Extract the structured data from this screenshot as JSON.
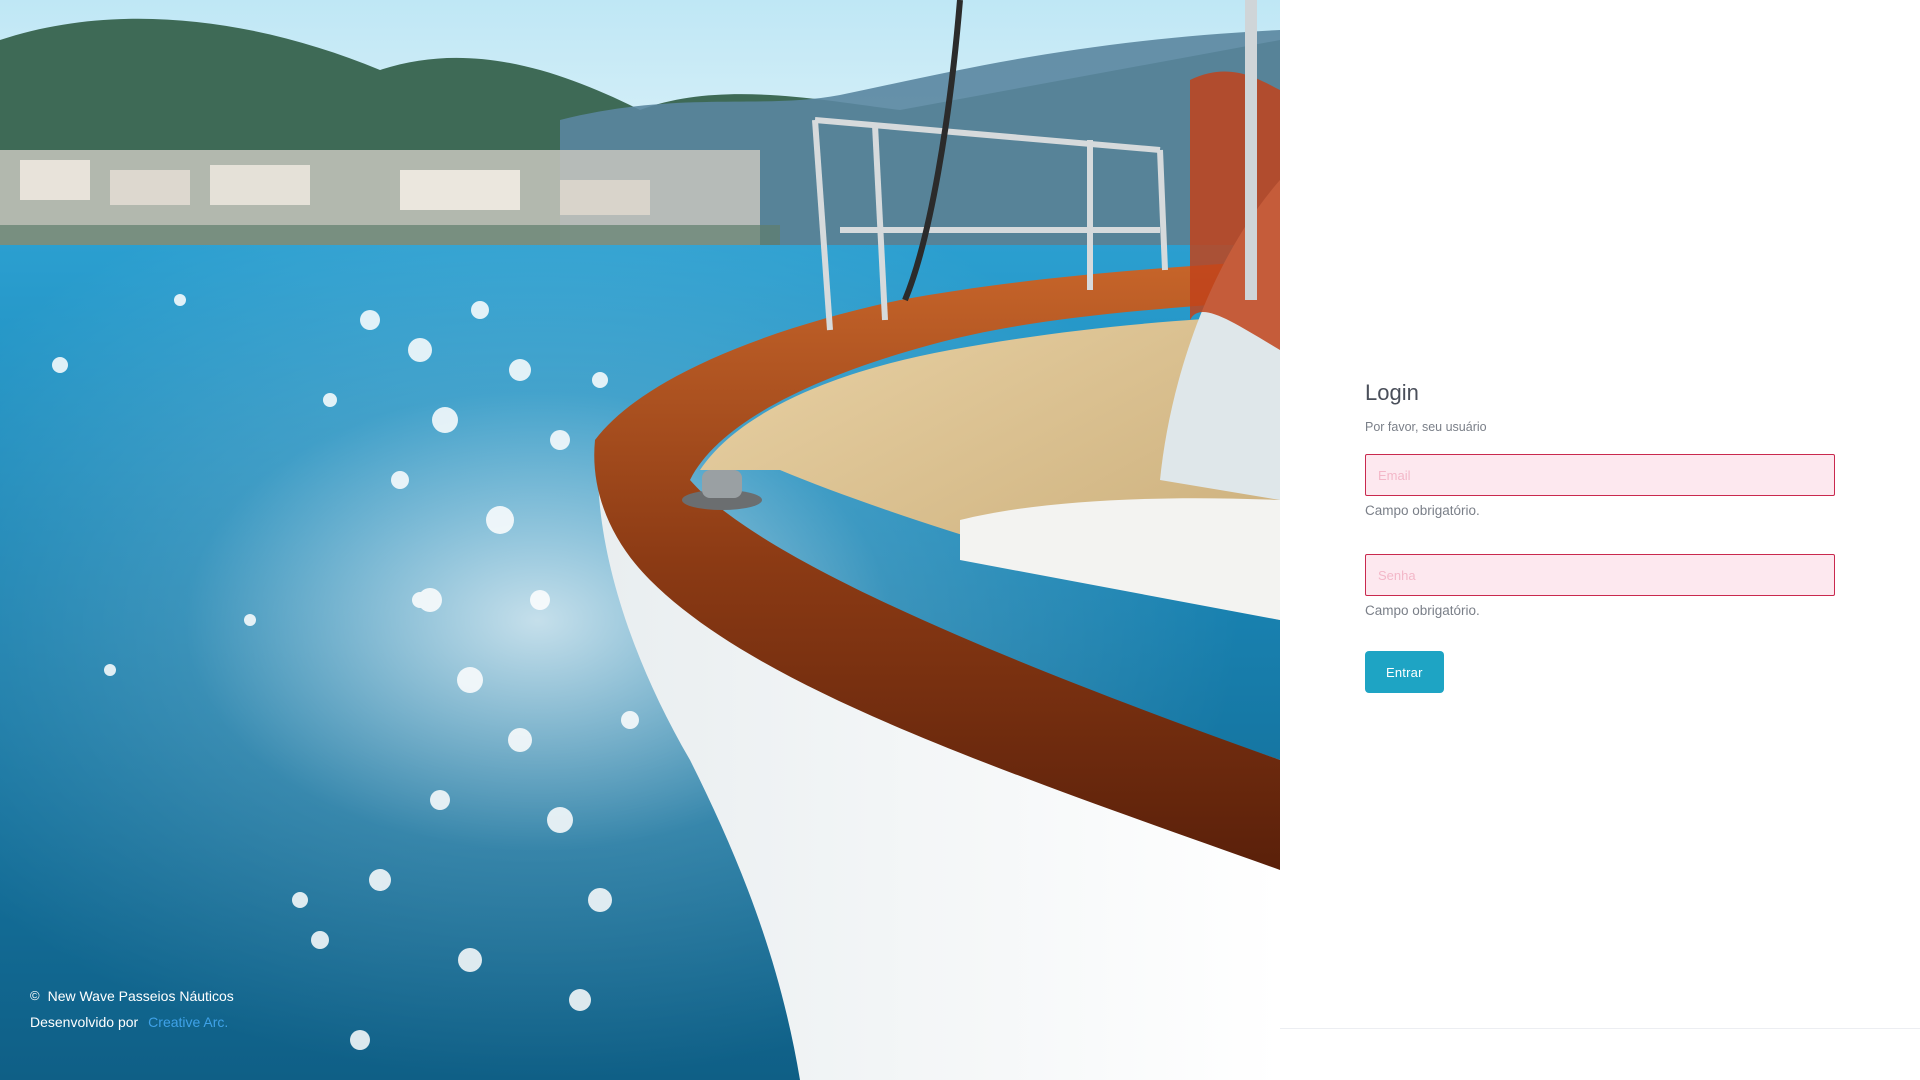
{
  "login": {
    "title": "Login",
    "subtitle": "Por favor, seu usuário",
    "email": {
      "placeholder": "Email",
      "value": "",
      "error": "Campo obrigatório."
    },
    "password": {
      "placeholder": "Senha",
      "value": "",
      "error": "Campo obrigatório."
    },
    "submit_label": "Entrar"
  },
  "footer": {
    "copyright_icon": "©",
    "company": "New Wave Passeios Náuticos",
    "developed_by": "Desenvolvido por",
    "developer_link": "Creative Arc."
  },
  "colors": {
    "accent": "#1ea4c4",
    "error_border": "#c9294e",
    "error_bg": "#fde8ef",
    "link": "#3fa2e8"
  }
}
